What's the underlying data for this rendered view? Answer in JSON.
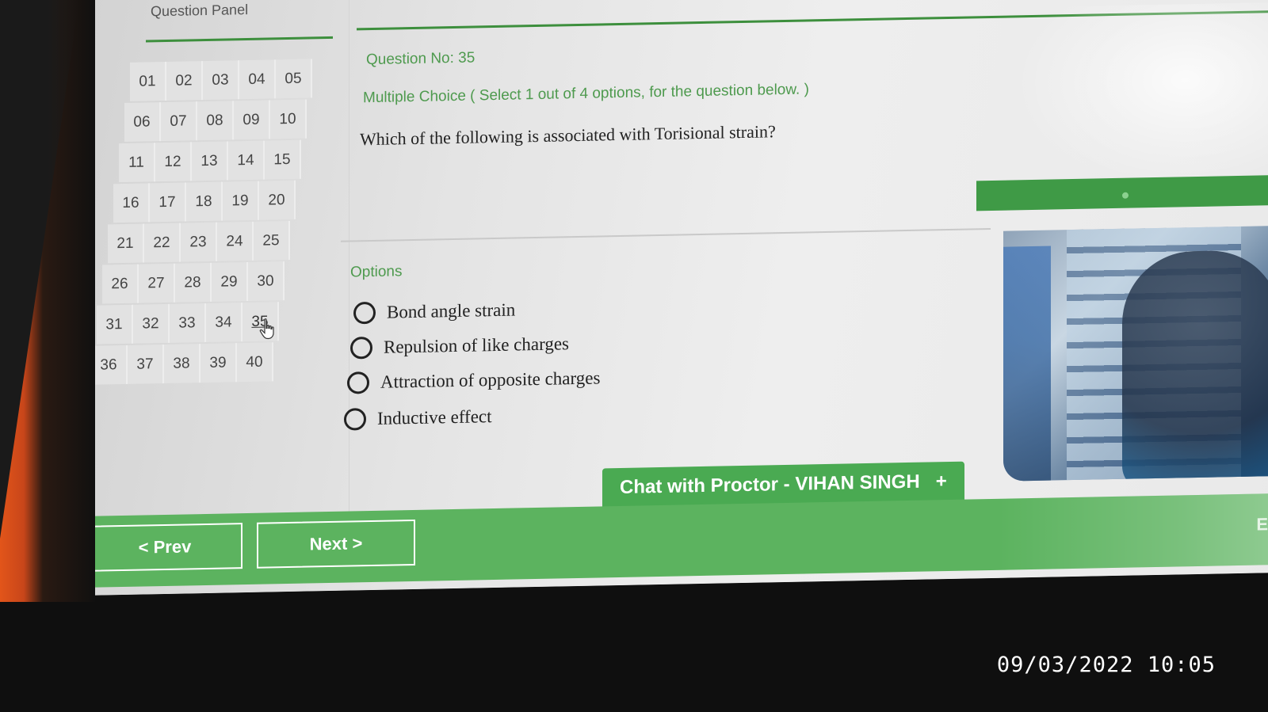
{
  "question_panel": {
    "title": "Question Panel",
    "numbers": [
      "01",
      "02",
      "03",
      "04",
      "05",
      "06",
      "07",
      "08",
      "09",
      "10",
      "11",
      "12",
      "13",
      "14",
      "15",
      "16",
      "17",
      "18",
      "19",
      "20",
      "21",
      "22",
      "23",
      "24",
      "25",
      "26",
      "27",
      "28",
      "29",
      "30",
      "31",
      "32",
      "33",
      "34",
      "35",
      "36",
      "37",
      "38",
      "39",
      "40"
    ],
    "current": "35"
  },
  "question": {
    "number_label": "Question No: 35",
    "type_label": "Multiple Choice ( Select 1 out of 4 options, for the question below. )",
    "text": "Which of the following is associated with Torisional strain?"
  },
  "options": {
    "label": "Options",
    "items": [
      {
        "text": "Bond angle strain",
        "selected": false
      },
      {
        "text": "Repulsion of like charges",
        "selected": false
      },
      {
        "text": "Attraction of opposite charges",
        "selected": false
      },
      {
        "text": "Inductive effect",
        "selected": false
      }
    ]
  },
  "chat": {
    "label": "Chat with Proctor - VIHAN SINGH",
    "plus": "+"
  },
  "navigation": {
    "prev_label": "< Prev",
    "next_label": "Next >",
    "end_label": "E"
  },
  "photo_timestamp": "09/03/2022 10:05",
  "colors": {
    "accent_green": "#5cb35f",
    "text_green": "#4e9a4e",
    "rule_green": "#3d8f3d"
  },
  "icons": {
    "cursor": "hand-pointer-icon",
    "option_radio": "radio-button-icon"
  }
}
